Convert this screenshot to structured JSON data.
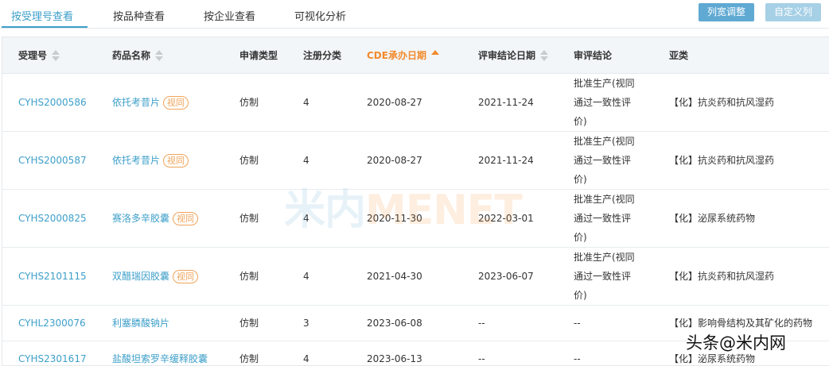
{
  "tabs": [
    {
      "label": "按受理号查看",
      "active": true
    },
    {
      "label": "按品种查看",
      "active": false
    },
    {
      "label": "按企业查看",
      "active": false
    },
    {
      "label": "可视化分析",
      "active": false
    }
  ],
  "buttons": {
    "column_width": "列宽调整",
    "custom_columns": "自定义列"
  },
  "columns": [
    {
      "label": "受理号",
      "sort": "both"
    },
    {
      "label": "药品名称",
      "sort": "both"
    },
    {
      "label": "申请类型",
      "sort": "none"
    },
    {
      "label": "注册分类",
      "sort": "none"
    },
    {
      "label": "CDE承办日期",
      "sort": "asc"
    },
    {
      "label": "评审结论日期",
      "sort": "both"
    },
    {
      "label": "审评结论",
      "sort": "none"
    },
    {
      "label": "亚类",
      "sort": "none"
    }
  ],
  "tag_label": "视同",
  "rows": [
    {
      "id": "CYHS2000586",
      "name": "依托考昔片",
      "tag": true,
      "type": "仿制",
      "cls": "4",
      "cde_date": "2020-08-27",
      "review_date": "2021-11-24",
      "conclusion": "批准生产(视同通过一致性评价)",
      "subclass": "【化】抗炎药和抗风湿药"
    },
    {
      "id": "CYHS2000587",
      "name": "依托考昔片",
      "tag": true,
      "type": "仿制",
      "cls": "4",
      "cde_date": "2020-08-27",
      "review_date": "2021-11-24",
      "conclusion": "批准生产(视同通过一致性评价)",
      "subclass": "【化】抗炎药和抗风湿药"
    },
    {
      "id": "CYHS2000825",
      "name": "赛洛多辛胶囊",
      "tag": true,
      "type": "仿制",
      "cls": "4",
      "cde_date": "2020-11-30",
      "review_date": "2022-03-01",
      "conclusion": "批准生产(视同通过一致性评价)",
      "subclass": "【化】泌尿系统药物"
    },
    {
      "id": "CYHS2101115",
      "name": "双醋瑞因胶囊",
      "tag": true,
      "type": "仿制",
      "cls": "4",
      "cde_date": "2021-04-30",
      "review_date": "2023-06-07",
      "conclusion": "批准生产(视同通过一致性评价)",
      "subclass": "【化】抗炎药和抗风湿药"
    },
    {
      "id": "CYHL2300076",
      "name": "利塞膦酸钠片",
      "tag": false,
      "type": "仿制",
      "cls": "3",
      "cde_date": "2023-06-08",
      "review_date": "--",
      "conclusion": "--",
      "subclass": "【化】影响骨结构及其矿化的药物"
    },
    {
      "id": "CYHS2301617",
      "name": "盐酸坦索罗辛缓释胶囊",
      "tag": false,
      "type": "仿制",
      "cls": "4",
      "cde_date": "2023-06-13",
      "review_date": "--",
      "conclusion": "--",
      "subclass": "【化】泌尿系统药物"
    }
  ],
  "watermark": {
    "part_a": "米内",
    "part_b": "MENET"
  },
  "corner_mark": "头条@米内网"
}
